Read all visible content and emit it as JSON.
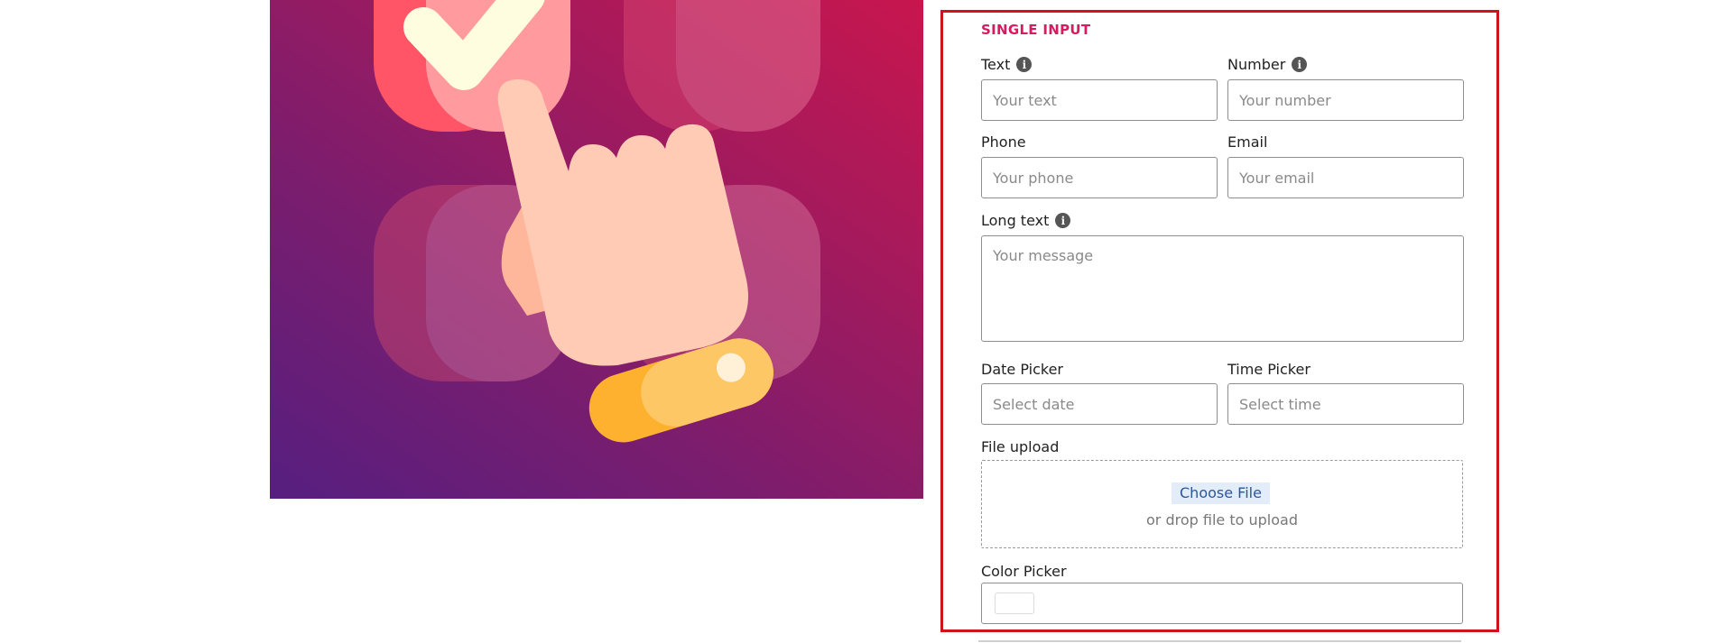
{
  "hero": {
    "alt": "Hand pressing a checked button illustration",
    "colors": {
      "gradient_start": "#561f80",
      "gradient_end": "#c8164e",
      "tile_red": "#ff5567",
      "tile_pink": "#ff9a9e",
      "check": "#fffde0",
      "skin": "#ffcbb4",
      "skin_shadow": "#ffb79b",
      "cuff_dark": "#fdb12e",
      "cuff_light": "#fec765",
      "cuff_button": "#fff0d8"
    }
  },
  "form": {
    "section_title": "SINGLE INPUT",
    "accent_color": "#d81b60",
    "highlight_border_color": "#d0121b",
    "fields": {
      "text": {
        "label": "Text",
        "placeholder": "Your text",
        "value": "",
        "has_info": true
      },
      "number": {
        "label": "Number",
        "placeholder": "Your number",
        "value": "",
        "has_info": true
      },
      "phone": {
        "label": "Phone",
        "placeholder": "Your phone",
        "value": ""
      },
      "email": {
        "label": "Email",
        "placeholder": "Your email",
        "value": ""
      },
      "long_text": {
        "label": "Long text",
        "placeholder": "Your message",
        "value": "",
        "has_info": true
      },
      "date": {
        "label": "Date Picker",
        "placeholder": "Select date",
        "value": ""
      },
      "time": {
        "label": "Time Picker",
        "placeholder": "Select time",
        "value": ""
      },
      "file": {
        "label": "File upload",
        "button": "Choose File",
        "hint": "or drop file to upload"
      },
      "color": {
        "label": "Color Picker",
        "value": "#ffffff"
      }
    },
    "info_icon_glyph": "i"
  }
}
